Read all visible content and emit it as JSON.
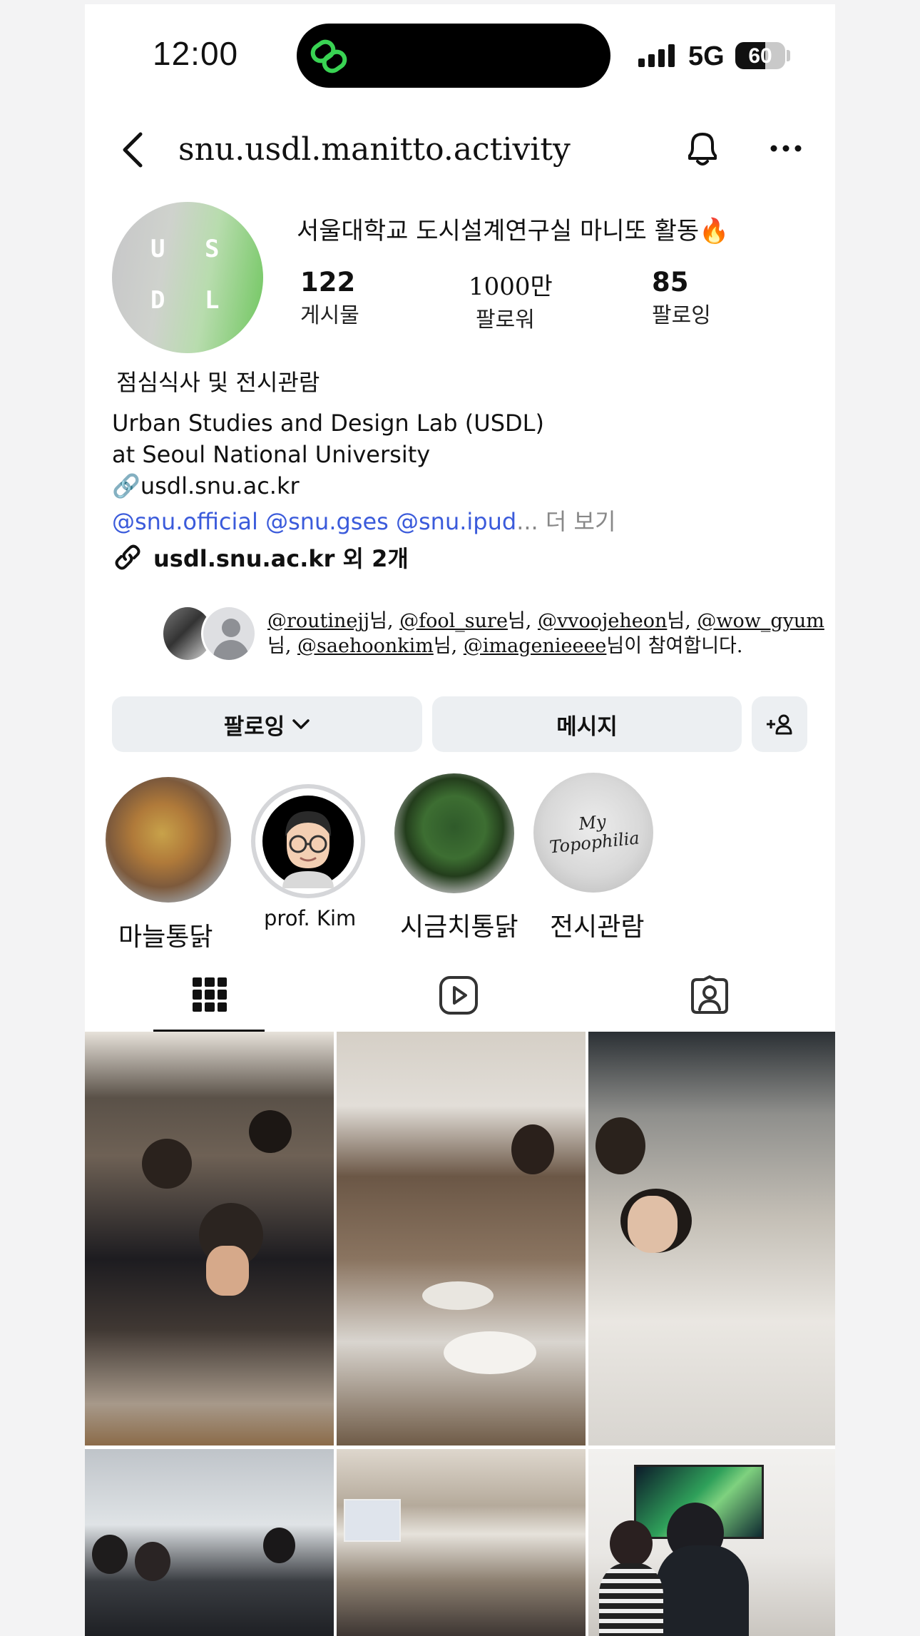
{
  "status_bar": {
    "time": "12:00",
    "network": "5G",
    "battery": "60"
  },
  "header": {
    "username": "snu.usdl.manitto.activity"
  },
  "profile": {
    "avatar_letters": [
      "U",
      "S",
      "D",
      "L"
    ],
    "name": "서울대학교 도시설계연구실 마니또 활동🔥",
    "stats": [
      {
        "value": "122",
        "label": "게시물"
      },
      {
        "value": "1000만",
        "label": "팔로워"
      },
      {
        "value": "85",
        "label": "팔로잉"
      }
    ],
    "category": "점심식사 및 전시관람",
    "bio_lines": [
      "Urban Studies and Design Lab (USDL)",
      "at Seoul National University",
      "🔗usdl.snu.ac.kr"
    ],
    "mentions": "@snu.official @snu.gses @snu.ipud",
    "mentions_ellipsis": "...",
    "more_label": " 더 보기",
    "link": "usdl.snu.ac.kr 외 2개"
  },
  "followed_by": {
    "users": [
      "@routinejj",
      "@fool_sure",
      "@vvoojeheon",
      "@wow_gyum",
      "@saehoonkim",
      "@imagenieeee"
    ],
    "suffix_each": "님, ",
    "suffix_last": "님이 참여합니다."
  },
  "actions": {
    "following": "팔로잉",
    "message": "메시지"
  },
  "highlights": [
    {
      "label": "마늘통닭"
    },
    {
      "label": "prof. Kim"
    },
    {
      "label": "시금치통닭"
    },
    {
      "label": "전시관람",
      "cover_text": "My Topophilia"
    }
  ],
  "tabs": [
    "grid",
    "reels",
    "tagged"
  ]
}
